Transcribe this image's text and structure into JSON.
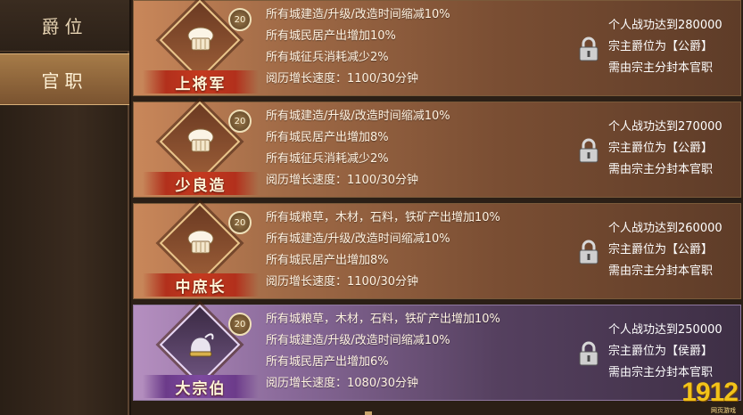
{
  "sidebar": {
    "tabs": [
      {
        "label": "爵位",
        "active": false
      },
      {
        "label": "官职",
        "active": true
      }
    ]
  },
  "level_badge_text": "20",
  "ranks": [
    {
      "title": "上将军",
      "theme": "orange",
      "icon": "chef-hat-icon",
      "effects": [
        "所有城建造/升级/改造时间缩减10%",
        "所有城民居产出增加10%",
        "所有城征兵消耗减少2%",
        "阅历增长速度：1100/30分钟"
      ],
      "requirements": [
        "个人战功达到280000",
        "宗主爵位为【公爵】",
        "需由宗主分封本官职"
      ],
      "locked": true
    },
    {
      "title": "少良造",
      "theme": "orange",
      "icon": "chef-hat-icon",
      "effects": [
        "所有城建造/升级/改造时间缩减10%",
        "所有城民居产出增加8%",
        "所有城征兵消耗减少2%",
        "阅历增长速度：1100/30分钟"
      ],
      "requirements": [
        "个人战功达到270000",
        "宗主爵位为【公爵】",
        "需由宗主分封本官职"
      ],
      "locked": true
    },
    {
      "title": "中庶长",
      "theme": "orange",
      "icon": "chef-hat-icon",
      "effects": [
        "所有城粮草，木材，石料，铁矿产出增加10%",
        "所有城建造/升级/改造时间缩减10%",
        "所有城民居产出增加8%",
        "阅历增长速度：1100/30分钟"
      ],
      "requirements": [
        "个人战功达到260000",
        "宗主爵位为【公爵】",
        "需由宗主分封本官职"
      ],
      "locked": true
    },
    {
      "title": "大宗伯",
      "theme": "purple",
      "icon": "feather-hat-icon",
      "effects": [
        "所有城粮草，木材，石料，铁矿产出增加10%",
        "所有城建造/升级/改造时间缩减10%",
        "所有城民居产出增加6%",
        "阅历增长速度：1080/30分钟"
      ],
      "requirements": [
        "个人战功达到250000",
        "宗主爵位为【侯爵】",
        "需由宗主分封本官职"
      ],
      "locked": true
    }
  ],
  "watermark": {
    "number": "1912",
    "sub": "网页游戏"
  },
  "colors": {
    "orange_row": "#a06a46",
    "purple_row": "#8a6a9a",
    "title_red": "#c4391f",
    "title_purple": "#7e4aa0"
  }
}
